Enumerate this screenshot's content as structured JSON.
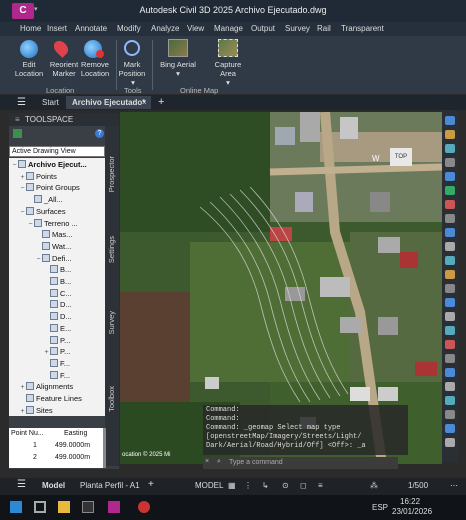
{
  "window": {
    "title": "Autodesk Civil 3D 2025   Archivo Ejecutado.dwg",
    "app_logo": "C"
  },
  "menu": [
    "Home",
    "Insert",
    "Annotate",
    "Modify",
    "Analyze",
    "View",
    "Manage",
    "Output",
    "Survey",
    "Rail",
    "Transparent"
  ],
  "ribbon": {
    "location_group": "Location",
    "tools_group": "Tools",
    "online_map_group": "Online Map",
    "edit_location": "Edit\nLocation",
    "reorient_marker": "Reorient\nMarker",
    "remove_location": "Remove\nLocation",
    "mark_position": "Mark\nPosition",
    "bing_aerial": "Bing Aerial",
    "capture_area": "Capture\nArea"
  },
  "tabs": {
    "start": "Start",
    "active": "Archivo Ejecutado*",
    "add": "+"
  },
  "toolspace": {
    "title": "TOOLSPACE",
    "view_select": "Active Drawing View",
    "side_tabs": [
      "Prospector",
      "Settings",
      "Survey",
      "Toolbox"
    ],
    "tree": [
      {
        "label": "Archivo Ejecut...",
        "indent": 0,
        "exp": "−",
        "bold": true
      },
      {
        "label": "Points",
        "indent": 1,
        "exp": "+"
      },
      {
        "label": "Point Groups",
        "indent": 1,
        "exp": "−"
      },
      {
        "label": "_All...",
        "indent": 2,
        "exp": ""
      },
      {
        "label": "Surfaces",
        "indent": 1,
        "exp": "−"
      },
      {
        "label": "Terreno ...",
        "indent": 2,
        "exp": "−"
      },
      {
        "label": "Mas...",
        "indent": 3,
        "exp": ""
      },
      {
        "label": "Wat...",
        "indent": 3,
        "exp": ""
      },
      {
        "label": "Defi...",
        "indent": 3,
        "exp": "−"
      },
      {
        "label": "B...",
        "indent": 4,
        "exp": ""
      },
      {
        "label": "B...",
        "indent": 4,
        "exp": ""
      },
      {
        "label": "C...",
        "indent": 4,
        "exp": ""
      },
      {
        "label": "D...",
        "indent": 4,
        "exp": ""
      },
      {
        "label": "D...",
        "indent": 4,
        "exp": ""
      },
      {
        "label": "E...",
        "indent": 4,
        "exp": ""
      },
      {
        "label": "P...",
        "indent": 4,
        "exp": ""
      },
      {
        "label": "P...",
        "indent": 4,
        "exp": "+"
      },
      {
        "label": "F...",
        "indent": 4,
        "exp": ""
      },
      {
        "label": "F...",
        "indent": 4,
        "exp": ""
      },
      {
        "label": "Alignments",
        "indent": 1,
        "exp": "+"
      },
      {
        "label": "Feature Lines",
        "indent": 1,
        "exp": ""
      },
      {
        "label": "Sites",
        "indent": 1,
        "exp": "+"
      }
    ],
    "table": {
      "headers": [
        "Point Nu...",
        "Easting"
      ],
      "rows": [
        [
          "1",
          "499.0000m"
        ],
        [
          "2",
          "499.0000m"
        ]
      ]
    }
  },
  "map": {
    "top_label": "Map",
    "viewcube_top": "TOP",
    "compass_w": "W",
    "copyright": "ocation © 2025 Mi"
  },
  "command": {
    "lines": [
      "Command:",
      "Command:",
      "Command: _geomap Select map type",
      "[openstreetMap/Imagery/Streets/Light/",
      "Dark/Aerial/Road/Hybrid/Off] <Off>: _a"
    ],
    "input_placeholder": "Type a command"
  },
  "statusbar": {
    "model_tab": "Model",
    "layout_tab": "Planta Perfil - A1",
    "add": "+",
    "model_btn": "MODEL",
    "scale": "1/500"
  },
  "taskbar": {
    "lang": "ESP",
    "time": "16:22",
    "date": "23/01/2026"
  },
  "colors": {
    "accent": "#b0288c",
    "ribbon_bg": "#2f3a46",
    "panel_bg": "#3a3f45"
  }
}
